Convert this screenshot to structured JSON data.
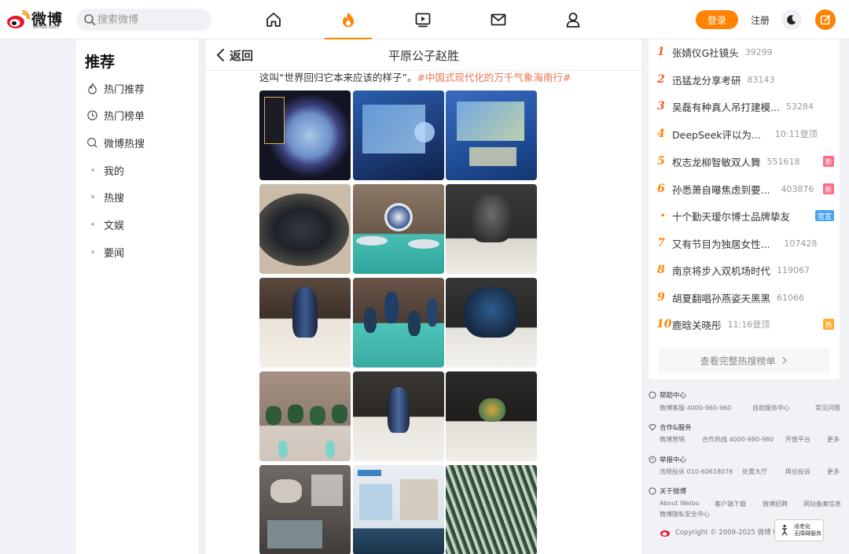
{
  "header": {
    "logo_text": "微博",
    "logo_sub": "weibo.com",
    "search_placeholder": "搜索微博",
    "nav": [
      {
        "name": "home-icon"
      },
      {
        "name": "hot-flame-icon"
      },
      {
        "name": "video-icon"
      },
      {
        "name": "mail-icon"
      },
      {
        "name": "profile-icon"
      }
    ],
    "login_label": "登录",
    "register_label": "注册",
    "accent": "#ff8200"
  },
  "sidebar": {
    "title": "推荐",
    "items": [
      {
        "label": "热门推荐",
        "icon": "flame-outline-icon"
      },
      {
        "label": "热门榜单",
        "icon": "clock-icon"
      },
      {
        "label": "微博热搜",
        "icon": "search-hot-icon"
      },
      {
        "label": "我的",
        "icon": "dot"
      },
      {
        "label": "热搜",
        "icon": "dot"
      },
      {
        "label": "文娱",
        "icon": "dot"
      },
      {
        "label": "要闻",
        "icon": "dot"
      }
    ]
  },
  "post": {
    "back_label": "返回",
    "author": "平原公子赵胜",
    "text_plain": "这叫“世界回归它本来应该的样子”。",
    "text_tag": "#中国式现代化的万千气象海南行#",
    "images": [
      "photo-display-porcelain-pile",
      "photo-map-panel-1",
      "photo-map-panel-2",
      "photo-blue-white-plate",
      "photo-plates-on-stand",
      "photo-dark-jar",
      "photo-blue-vase",
      "photo-small-vases-teal",
      "photo-painted-jar",
      "photo-green-jars",
      "photo-meiping-vase",
      "photo-teapot",
      "photo-exhibit-board",
      "photo-info-board",
      "photo-bamboo-slips"
    ]
  },
  "hot_search": {
    "items": [
      {
        "rank": "1",
        "title": "张婧仪G社镜头",
        "count": "39299",
        "badge": ""
      },
      {
        "rank": "2",
        "title": "迅猛龙分享考研",
        "count": "83143",
        "badge": ""
      },
      {
        "rank": "3",
        "title": "吴磊有种真人吊打建模...",
        "count": "53284",
        "badge": ""
      },
      {
        "rank": "4",
        "title": "DeepSeek评以为...",
        "count": "10:11登顶",
        "badge": ""
      },
      {
        "rank": "5",
        "title": "权志龙柳智敏双人舞",
        "count": "551618",
        "badge": "新"
      },
      {
        "rank": "6",
        "title": "孙悉萧自曝焦虑到要...",
        "count": "403876",
        "badge": "新"
      },
      {
        "rank": "•",
        "title": "十个勤天瑷尔博士品牌挚友",
        "count": "",
        "badge": "官宣"
      },
      {
        "rank": "7",
        "title": "又有节目为独居女性...",
        "count": "107428",
        "badge": ""
      },
      {
        "rank": "8",
        "title": "南京将步入双机场时代",
        "count": "119067",
        "badge": ""
      },
      {
        "rank": "9",
        "title": "胡夏翻唱孙燕姿天黑黑",
        "count": "61066",
        "badge": ""
      },
      {
        "rank": "10",
        "title": "鹿晗关晓彤",
        "count": "11:16登顶",
        "badge": "热"
      }
    ],
    "more_label": "查看完整热搜榜单"
  },
  "footer": {
    "help_title": "帮助中心",
    "help_links": [
      "微博客服 4000-960-960",
      "自助服务中心",
      "常见问题"
    ],
    "coop_title": "合作&服务",
    "coop_links": [
      "微博营销",
      "合作热线 4000-980-980",
      "开放平台",
      "更多"
    ],
    "report_title": "举报中心",
    "report_links": [
      "违规投诉 010-60618076",
      "处置大厅",
      "舆论投诉",
      "更多"
    ],
    "about_title": "关于微博",
    "about_links": [
      "About Weibo",
      "客户端下载",
      "微博招聘",
      "网站备案信息"
    ],
    "privacy_link": "微博隐私安全中心",
    "copyright": "Copyright © 2009-2025 微博 Weibo",
    "elder_line1": "适老化",
    "elder_line2": "无障碍服务"
  }
}
